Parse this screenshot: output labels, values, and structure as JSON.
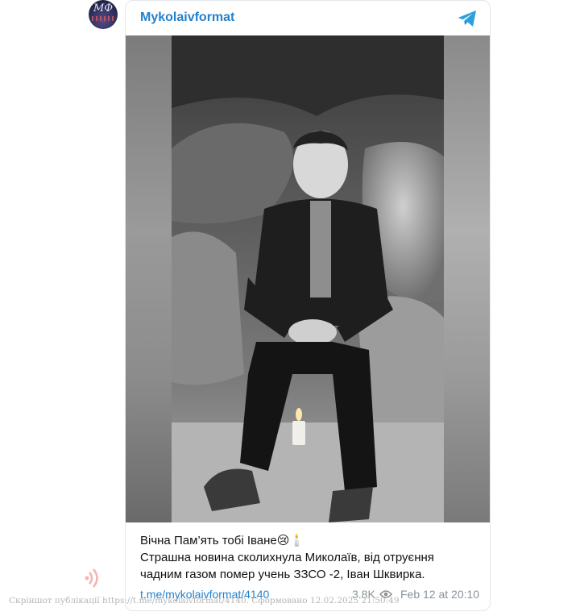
{
  "channel": {
    "name": "Mykolaivformat",
    "avatar_text": "МФ",
    "accent_color": "#2481cc"
  },
  "post": {
    "lines": [
      "Вічна Пам’ять тобі Іване😢🕯️",
      "Страшна новина сколихнула Миколаїв, від отруєння",
      "чадним газом помер учень ЗЗСО -2, Іван Шквирка."
    ],
    "link": "t.me/mykolaivformat/4140",
    "views": "3.8K",
    "date": "Feb 12 at 20:10"
  },
  "icons": {
    "telegram": "telegram-icon",
    "views": "eye-icon",
    "watermark": "sound-wave-icon"
  },
  "watermark": {
    "text": "Скріншот публікації https://t.me/mykolaivformat/4140. Сформовано 12.02.2025 21:50:49"
  }
}
